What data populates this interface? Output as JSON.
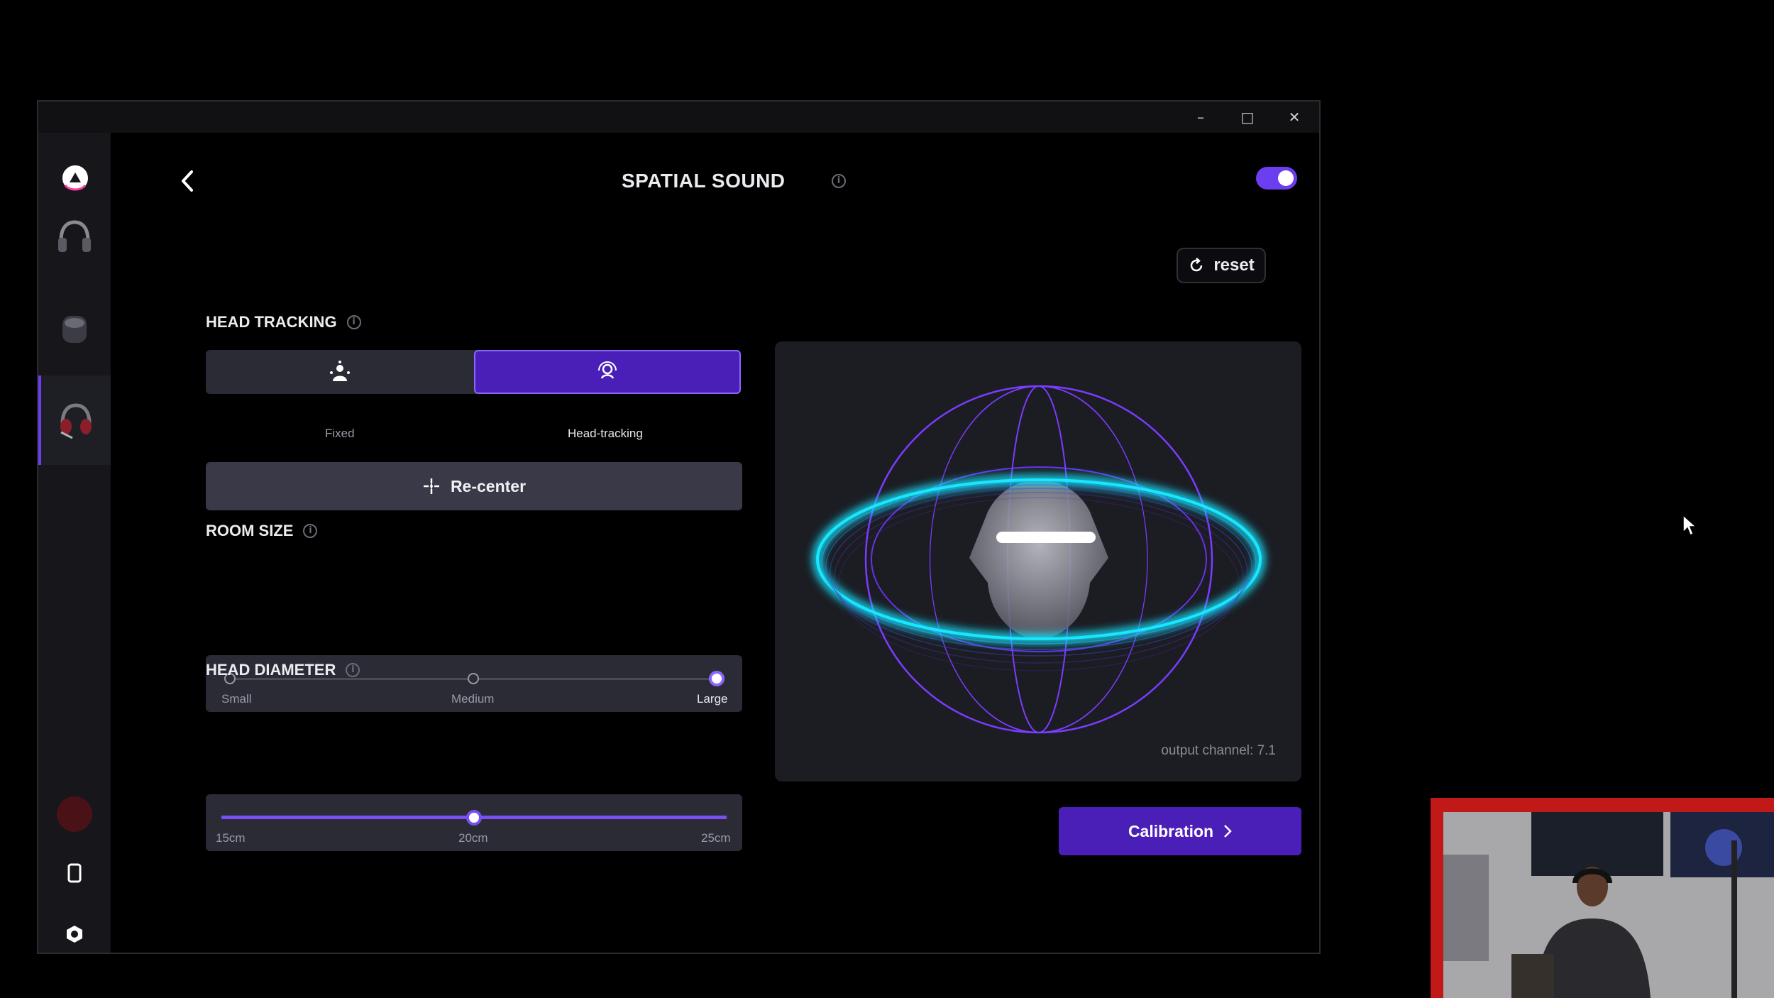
{
  "window": {
    "controls": {
      "minimize_icon": "minimize-icon",
      "maximize_icon": "maximize-icon",
      "close_icon": "close-icon"
    }
  },
  "sidebar": {
    "items": [
      {
        "name": "headphones",
        "icon": "headphones-icon"
      },
      {
        "name": "earbuds-case",
        "icon": "earbuds-icon"
      },
      {
        "name": "headset",
        "icon": "headset-icon",
        "active": true
      }
    ],
    "bottom_icons": [
      "profile-dot",
      "phone-icon",
      "settings-icon"
    ]
  },
  "header": {
    "title": "SPATIAL SOUND",
    "info_glyph": "i",
    "spatial_enabled": true
  },
  "reset_label": "reset",
  "head_tracking": {
    "label": "HEAD TRACKING",
    "info_glyph": "i",
    "options": [
      {
        "label": "Fixed",
        "icon": "fixed-head-icon",
        "selected": false
      },
      {
        "label": "Head-tracking",
        "icon": "head-tracking-icon",
        "selected": true
      }
    ],
    "recenter_label": "Re-center"
  },
  "room_size": {
    "label": "ROOM SIZE",
    "info_glyph": "i",
    "options": [
      "Small",
      "Medium",
      "Large"
    ],
    "selected": "Large"
  },
  "head_diameter": {
    "label": "HEAD DIAMETER",
    "info_glyph": "i",
    "min_label": "15cm",
    "mid_label": "20cm",
    "max_label": "25cm",
    "value_cm": 20,
    "min_cm": 15,
    "max_cm": 25
  },
  "visualizer": {
    "output_channel_text": "output channel: 7.1"
  },
  "calibration_label": "Calibration",
  "colors": {
    "accent": "#6d3df0",
    "accent_dark": "#4a1fb8",
    "ring_cyan": "#19e6ff",
    "sphere_purple": "#7a3cff"
  }
}
